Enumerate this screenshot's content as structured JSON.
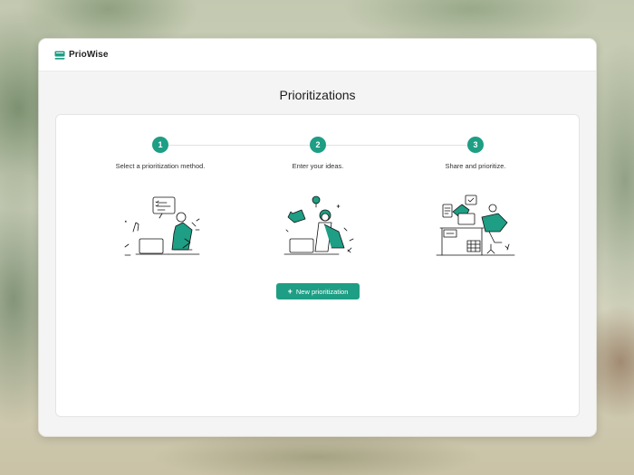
{
  "app": {
    "brand": "PrioWise"
  },
  "page": {
    "title": "Prioritizations"
  },
  "steps": [
    {
      "number": "1",
      "label": "Select a prioritization method."
    },
    {
      "number": "2",
      "label": "Enter your ideas."
    },
    {
      "number": "3",
      "label": "Share and prioritize."
    }
  ],
  "actions": {
    "new_button": "New prioritization",
    "new_button_icon": "plus-icon"
  },
  "colors": {
    "accent": "#1e9e84",
    "surface": "#ffffff",
    "window_bg": "#f4f4f5"
  },
  "icons": {
    "logo": "priowise-logo-icon"
  }
}
